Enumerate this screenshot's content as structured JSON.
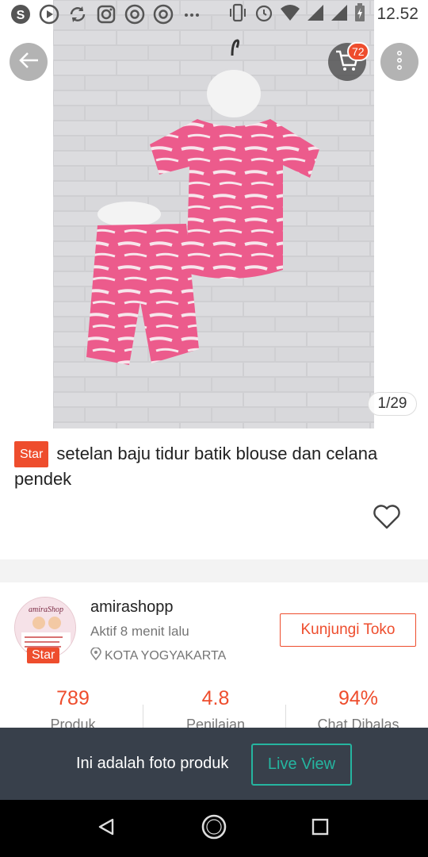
{
  "status_bar": {
    "time": "12.52",
    "left_icons": [
      "s-app-icon",
      "play-circle-icon",
      "sync-icon",
      "instagram-icon",
      "chrome-icon",
      "chrome-icon",
      "more-dots-icon"
    ],
    "right_icons": [
      "vibrate-icon",
      "alarm-icon",
      "wifi-icon",
      "signal-icon",
      "signal-icon",
      "battery-charging-icon"
    ]
  },
  "header": {
    "cart_count": "72"
  },
  "gallery": {
    "counter": "1/29"
  },
  "product": {
    "badge": "Star",
    "title": "setelan baju tidur batik blouse dan celana pendek"
  },
  "shop": {
    "name": "amirashopp",
    "active": "Aktif 8 menit lalu",
    "location": "KOTA YOGYAKARTA",
    "badge": "Star",
    "visit_label": "Kunjungi Toko",
    "avatar_text": "amiraShop"
  },
  "stats": [
    {
      "value": "789",
      "label": "Produk"
    },
    {
      "value": "4.8",
      "label": "Penilaian"
    },
    {
      "value": "94%",
      "label": "Chat Dibalas"
    }
  ],
  "banner": {
    "text": "Ini adalah foto produk",
    "button": "Live View"
  },
  "colors": {
    "accent": "#ee4d2d",
    "banner_bg": "#38404b",
    "live_view": "#25b5a0"
  }
}
